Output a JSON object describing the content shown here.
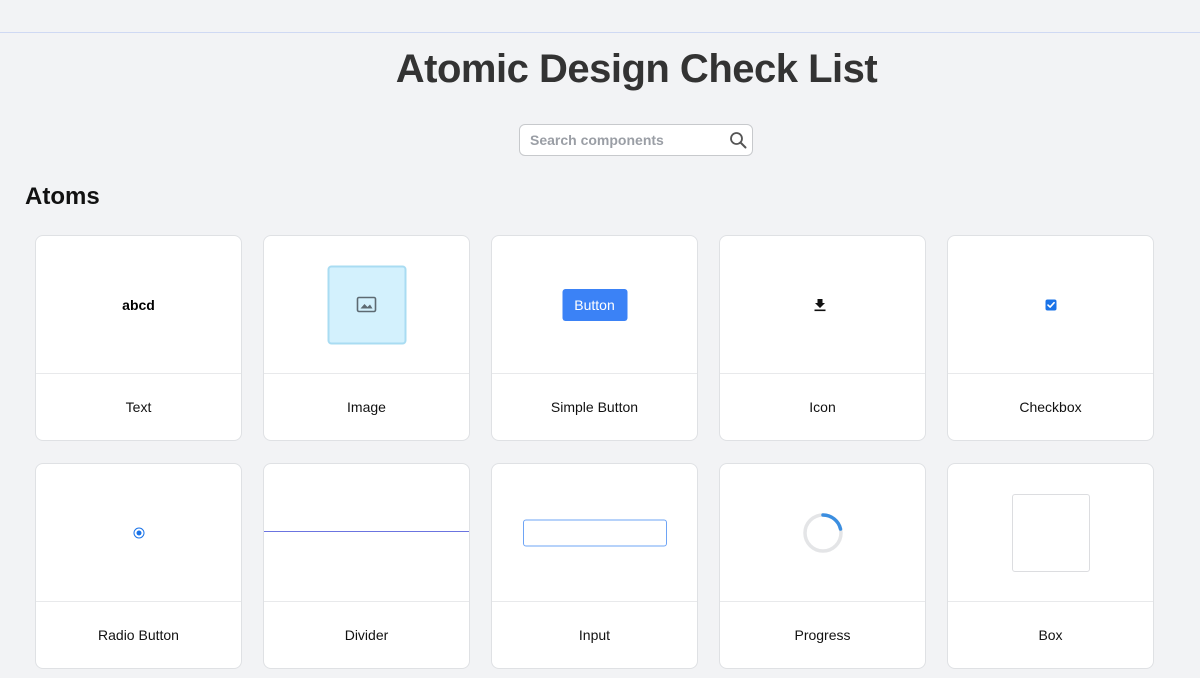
{
  "page": {
    "title": "Atomic Design Check List"
  },
  "search": {
    "placeholder": "Search components",
    "value": ""
  },
  "sections": [
    {
      "title": "Atoms",
      "cards": [
        {
          "label": "Text",
          "demo_text": "abcd"
        },
        {
          "label": "Image",
          "icon": "image-icon"
        },
        {
          "label": "Simple Button",
          "button_text": "Button"
        },
        {
          "label": "Icon",
          "icon": "download-icon"
        },
        {
          "label": "Checkbox",
          "checked": true
        },
        {
          "label": "Radio Button",
          "selected": true
        },
        {
          "label": "Divider"
        },
        {
          "label": "Input",
          "value": ""
        },
        {
          "label": "Progress",
          "icon": "spinner-icon"
        },
        {
          "label": "Box"
        }
      ]
    }
  ],
  "colors": {
    "background": "#f2f3f5",
    "accent": "#3b82f6",
    "checkbox": "#1a73e8",
    "divider": "#6b74e0",
    "image_fill": "#d3f1fd",
    "spinner": "#3b8ee0"
  }
}
